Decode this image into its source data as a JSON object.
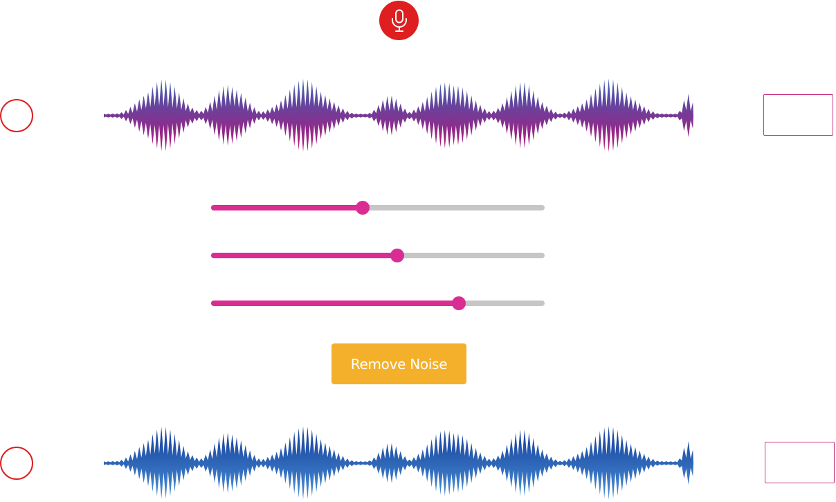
{
  "colors": {
    "mic_red": "#df1f1f",
    "slider_active": "#d92d93",
    "slider_track": "#c6c6c6",
    "button_orange": "#f4b02a",
    "wave_input_top": "#3a5fb0",
    "wave_input_bottom": "#b5147a",
    "wave_output_top": "#123b98",
    "wave_output_bottom": "#4a90d6"
  },
  "header": {
    "mic_icon": "microphone-icon"
  },
  "input_track": {
    "play_icon": "circle-outline"
  },
  "output_track": {
    "play_icon": "circle-outline"
  },
  "sliders": [
    {
      "value": 0.455
    },
    {
      "value": 0.558
    },
    {
      "value": 0.742
    }
  ],
  "actions": {
    "remove_noise_label": "Remove Noise"
  }
}
